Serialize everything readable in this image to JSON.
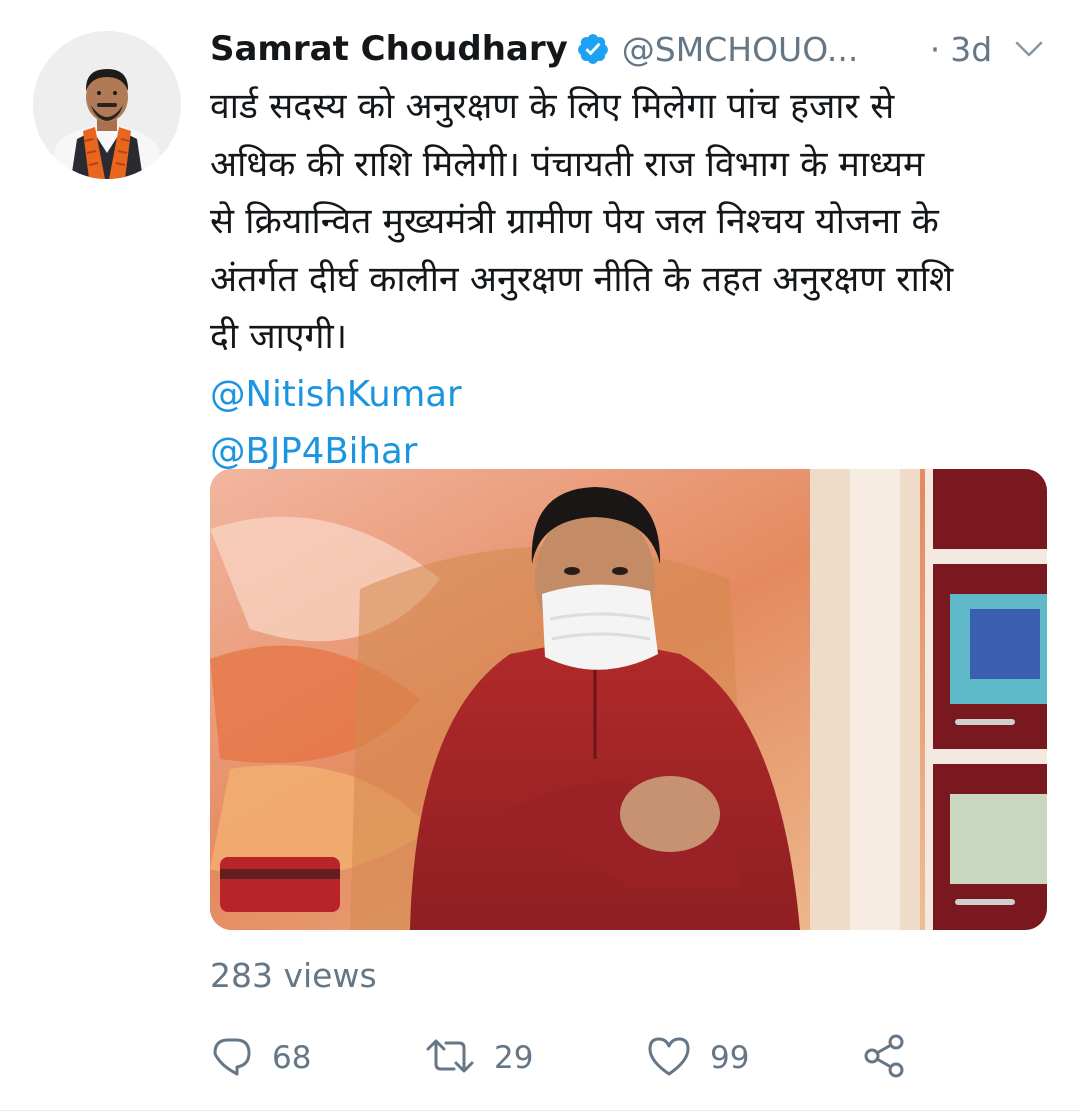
{
  "tweet": {
    "author_name": "Samrat Choudhary",
    "author_handle": "@SMCHOUO...",
    "separator": "·",
    "timestamp": "3d",
    "text_lines": [
      "वार्ड सदस्य को अनुरक्षण के लिए मिलेगा पांच हजार से",
      "अधिक की राशि मिलेगी। पंचायती राज विभाग के माध्यम",
      "से क्रियान्वित मुख्यमंत्री ग्रामीण पेय जल निश्चय योजना के",
      "अंतर्गत दीर्घ कालीन अनुरक्षण नीति के तहत अनुरक्षण राशि",
      "दी जाएगी।"
    ],
    "mentions": [
      "@NitishKumar",
      "@BJP4Bihar"
    ],
    "views": "283 views",
    "actions": {
      "reply_count": "68",
      "retweet_count": "29",
      "like_count": "99"
    }
  },
  "icons": {
    "verified": "verified-badge-icon",
    "menu": "chevron-down-icon",
    "reply": "reply-icon",
    "retweet": "retweet-icon",
    "like": "heart-icon",
    "share": "share-icon"
  },
  "colors": {
    "link": "#1b95e0",
    "secondary_text": "#657786",
    "primary_text": "#14171a",
    "verified": "#1da1f2"
  }
}
